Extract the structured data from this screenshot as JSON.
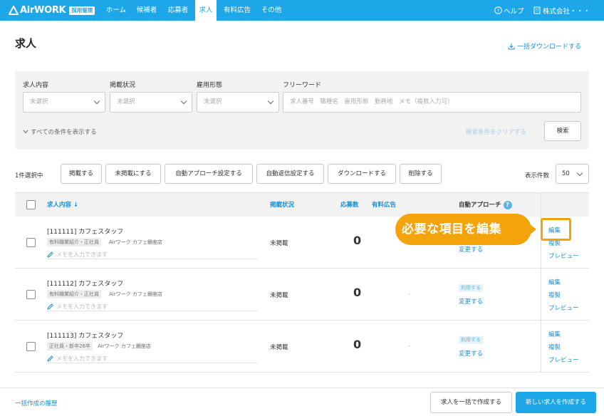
{
  "nav": {
    "logo_text": "AirWORK",
    "logo_badge": "採用管理",
    "items": [
      {
        "label": "ホーム"
      },
      {
        "label": "候補者"
      },
      {
        "label": "応募者"
      },
      {
        "label": "求人"
      },
      {
        "label": "有料広告"
      },
      {
        "label": "その他"
      }
    ],
    "active_index": 3,
    "help": "ヘルプ",
    "company": "株式会社・・・"
  },
  "page": {
    "title": "求人",
    "download_all": "一括ダウンロードする"
  },
  "search": {
    "fields": [
      {
        "label": "求人内容",
        "value": "未選択"
      },
      {
        "label": "掲載状況",
        "value": "未選択"
      },
      {
        "label": "雇用形態",
        "value": "未選択"
      }
    ],
    "freeword_label": "フリーワード",
    "freeword_placeholder": "求人番号　職種名　雇用形態　勤務地　メモ（複数入力可）",
    "show_all": "すべての条件を表示する",
    "clear": "検索条件をクリアする",
    "submit": "検索"
  },
  "actions": {
    "selected": "1件選択中",
    "buttons": [
      "掲載する",
      "未掲載にする",
      "自動アプローチ設定する",
      "自動返信設定する",
      "ダウンロードする",
      "削除する"
    ],
    "per_page_label": "表示件数",
    "per_page": "50"
  },
  "table": {
    "headers": {
      "content": "求人内容",
      "sort_arrow": "↓",
      "status": "掲載状況",
      "apps": "応募数",
      "paid": "有料広告",
      "auto": "自動アプローチ",
      "help": "?"
    },
    "rows": [
      {
        "title": "[111111] カフェスタッフ",
        "tag": "有料職業紹介・正社員",
        "store": "Airワーク カフェ銀座店",
        "memo": "メモを入力できます",
        "status": "未掲載",
        "apps": "0",
        "paid": "",
        "use_badge": "",
        "change": "変更する",
        "links": [
          "編集",
          "複製",
          "プレビュー"
        ]
      },
      {
        "title": "[111112] カフェスタッフ",
        "tag": "有料職業紹介・正社員",
        "store": "Airワーク カフェ銀座店",
        "memo": "メモを入力できます",
        "status": "未掲載",
        "apps": "0",
        "paid": "-",
        "use_badge": "利用する",
        "change": "変更する",
        "links": [
          "編集",
          "複製",
          "プレビュー"
        ]
      },
      {
        "title": "[111113] カフェスタッフ",
        "tag": "正社員・新卒26卒",
        "store": "Airワーク カフェ銀座店",
        "memo": "メモを入力できます",
        "status": "未掲載",
        "apps": "0",
        "paid": "-",
        "use_badge": "利用する",
        "change": "変更する",
        "links": [
          "編集",
          "複製",
          "プレビュー"
        ]
      }
    ]
  },
  "callout": "必要な項目を編集",
  "footer": {
    "history": "一括作成の履歴",
    "bulk_create": "求人を一括で作成する",
    "new_create": "新しい求人を作成する"
  },
  "colors": {
    "brand": "#1ea7e8",
    "link": "#1a8fd2",
    "callout": "#f5a30a"
  }
}
